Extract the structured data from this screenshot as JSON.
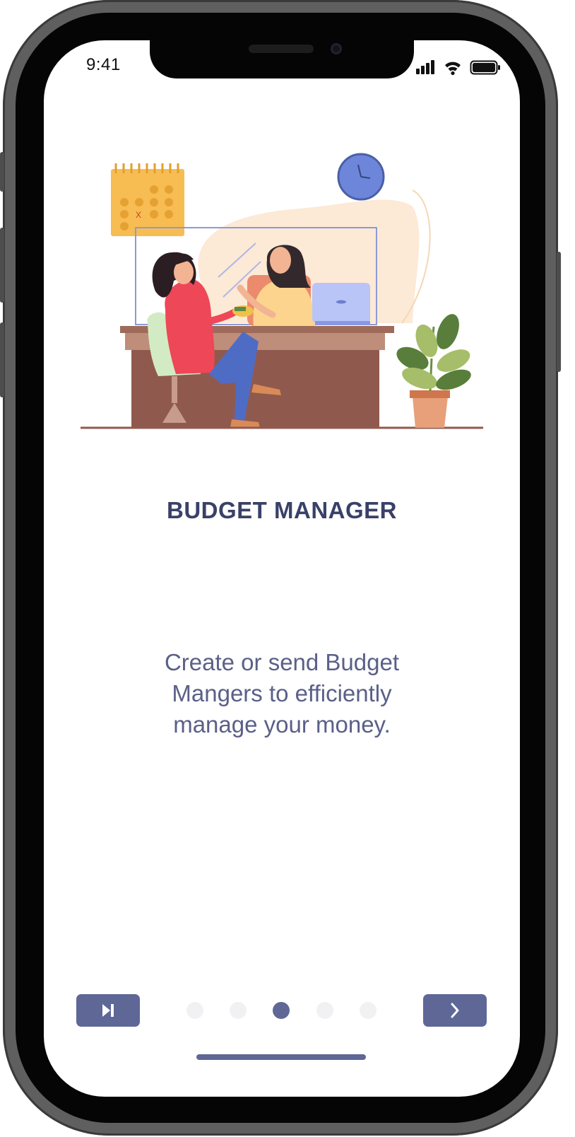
{
  "status_bar": {
    "time": "9:41"
  },
  "onboarding": {
    "title": "BUDGET MANAGER",
    "description": "Create or send Budget Mangers to efficiently manage your money.",
    "current_page": 3,
    "total_pages": 5
  },
  "navigation": {
    "skip_icon": "skip-forward-icon",
    "next_icon": "chevron-right-icon"
  },
  "colors": {
    "accent": "#5e6796",
    "title": "#3a4168",
    "text": "#5a6088",
    "dot_inactive": "#f1f1f3"
  }
}
